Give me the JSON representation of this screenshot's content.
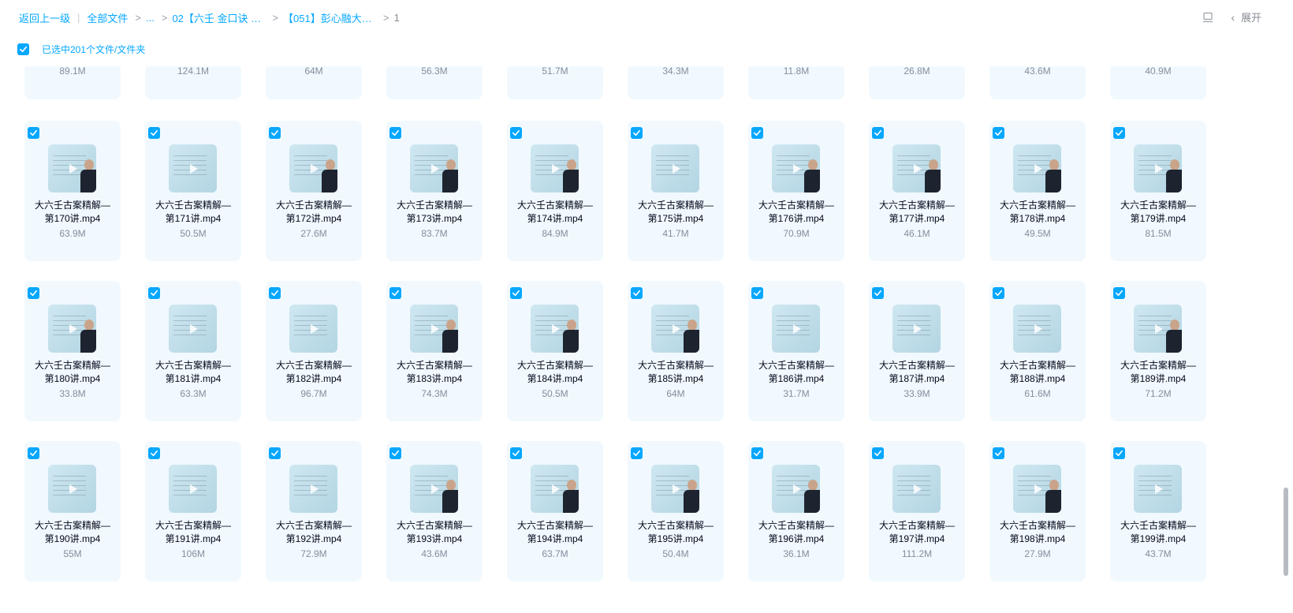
{
  "breadcrumb": {
    "back": "返回上一级",
    "all_files": "全部文件",
    "ellipsis": "...",
    "item1": "02【六壬 金口诀 合...",
    "item2": "【051】彭心融大六...",
    "current": "1"
  },
  "toolbar": {
    "expand_label": "展开"
  },
  "selection": {
    "text": "已选中201个文件/文件夹"
  },
  "partial_sizes": [
    "89.1M",
    "124.1M",
    "64M",
    "56.3M",
    "51.7M",
    "34.3M",
    "11.8M",
    "26.8M",
    "43.6M",
    "40.9M"
  ],
  "rows": [
    [
      {
        "line1": "大六壬古案精解—",
        "line2": "第170讲.mp4",
        "size": "63.9M",
        "person": true
      },
      {
        "line1": "大六壬古案精解—",
        "line2": "第171讲.mp4",
        "size": "50.5M",
        "person": false
      },
      {
        "line1": "大六壬古案精解—",
        "line2": "第172讲.mp4",
        "size": "27.6M",
        "person": true
      },
      {
        "line1": "大六壬古案精解—",
        "line2": "第173讲.mp4",
        "size": "83.7M",
        "person": true
      },
      {
        "line1": "大六壬古案精解—",
        "line2": "第174讲.mp4",
        "size": "84.9M",
        "person": true
      },
      {
        "line1": "大六壬古案精解—",
        "line2": "第175讲.mp4",
        "size": "41.7M",
        "person": false
      },
      {
        "line1": "大六壬古案精解—",
        "line2": "第176讲.mp4",
        "size": "70.9M",
        "person": true
      },
      {
        "line1": "大六壬古案精解—",
        "line2": "第177讲.mp4",
        "size": "46.1M",
        "person": true
      },
      {
        "line1": "大六壬古案精解—",
        "line2": "第178讲.mp4",
        "size": "49.5M",
        "person": true
      },
      {
        "line1": "大六壬古案精解—",
        "line2": "第179讲.mp4",
        "size": "81.5M",
        "person": true
      }
    ],
    [
      {
        "line1": "大六壬古案精解—",
        "line2": "第180讲.mp4",
        "size": "33.8M",
        "person": true
      },
      {
        "line1": "大六壬古案精解—",
        "line2": "第181讲.mp4",
        "size": "63.3M",
        "person": false
      },
      {
        "line1": "大六壬古案精解—",
        "line2": "第182讲.mp4",
        "size": "96.7M",
        "person": false
      },
      {
        "line1": "大六壬古案精解—",
        "line2": "第183讲.mp4",
        "size": "74.3M",
        "person": true
      },
      {
        "line1": "大六壬古案精解—",
        "line2": "第184讲.mp4",
        "size": "50.5M",
        "person": true
      },
      {
        "line1": "大六壬古案精解—",
        "line2": "第185讲.mp4",
        "size": "64M",
        "person": true
      },
      {
        "line1": "大六壬古案精解—",
        "line2": "第186讲.mp4",
        "size": "31.7M",
        "person": false
      },
      {
        "line1": "大六壬古案精解—",
        "line2": "第187讲.mp4",
        "size": "33.9M",
        "person": false
      },
      {
        "line1": "大六壬古案精解—",
        "line2": "第188讲.mp4",
        "size": "61.6M",
        "person": false
      },
      {
        "line1": "大六壬古案精解—",
        "line2": "第189讲.mp4",
        "size": "71.2M",
        "person": true
      }
    ],
    [
      {
        "line1": "大六壬古案精解—",
        "line2": "第190讲.mp4",
        "size": "55M",
        "person": false
      },
      {
        "line1": "大六壬古案精解—",
        "line2": "第191讲.mp4",
        "size": "106M",
        "person": false
      },
      {
        "line1": "大六壬古案精解—",
        "line2": "第192讲.mp4",
        "size": "72.9M",
        "person": false
      },
      {
        "line1": "大六壬古案精解—",
        "line2": "第193讲.mp4",
        "size": "43.6M",
        "person": true
      },
      {
        "line1": "大六壬古案精解—",
        "line2": "第194讲.mp4",
        "size": "63.7M",
        "person": true
      },
      {
        "line1": "大六壬古案精解—",
        "line2": "第195讲.mp4",
        "size": "50.4M",
        "person": true
      },
      {
        "line1": "大六壬古案精解—",
        "line2": "第196讲.mp4",
        "size": "36.1M",
        "person": true
      },
      {
        "line1": "大六壬古案精解—",
        "line2": "第197讲.mp4",
        "size": "111.2M",
        "person": false
      },
      {
        "line1": "大六壬古案精解—",
        "line2": "第198讲.mp4",
        "size": "27.9M",
        "person": true
      },
      {
        "line1": "大六壬古案精解—",
        "line2": "第199讲.mp4",
        "size": "43.7M",
        "person": false
      }
    ]
  ],
  "colors": {
    "accent": "#06a7ff",
    "card_bg": "#f1f9fe",
    "text": "#03081a",
    "muted": "#878c9c"
  },
  "icons": {
    "checkbox": "checkbox-checked-icon",
    "play": "play-icon",
    "monitor": "monitor-icon",
    "chevron": "chevron-left-icon"
  }
}
